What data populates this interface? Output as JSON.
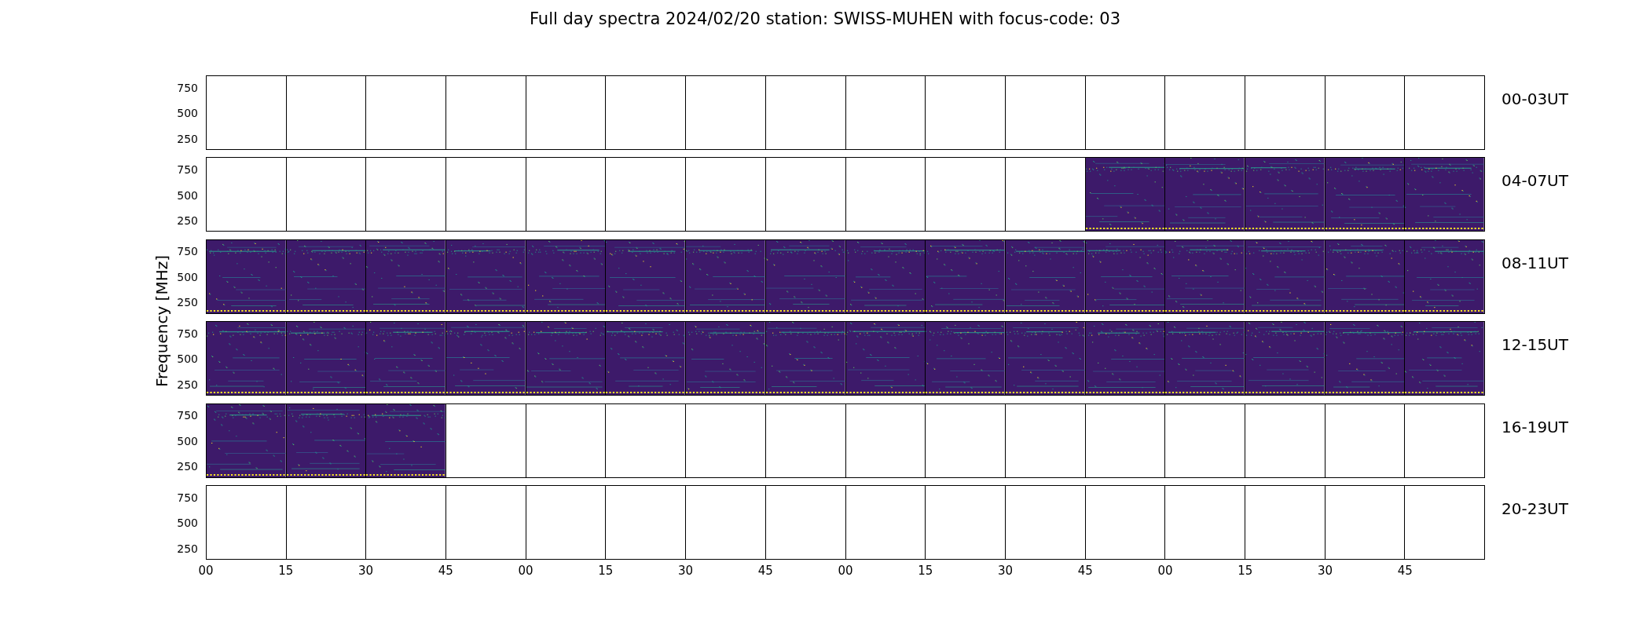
{
  "title": "Full day spectra 2024/02/20 station: SWISS-MUHEN with focus-code: 03",
  "ylabel": "Frequency [MHz]",
  "rows": [
    {
      "label": "00-03UT",
      "yticks": [
        "750",
        "500",
        "250"
      ],
      "panels": [
        {
          "filled": false
        },
        {
          "filled": false
        },
        {
          "filled": false
        },
        {
          "filled": false
        },
        {
          "filled": false
        },
        {
          "filled": false
        },
        {
          "filled": false
        },
        {
          "filled": false
        },
        {
          "filled": false
        },
        {
          "filled": false
        },
        {
          "filled": false
        },
        {
          "filled": false
        },
        {
          "filled": false
        },
        {
          "filled": false
        },
        {
          "filled": false
        },
        {
          "filled": false
        }
      ]
    },
    {
      "label": "04-07UT",
      "yticks": [
        "750",
        "500",
        "250"
      ],
      "panels": [
        {
          "filled": false
        },
        {
          "filled": false
        },
        {
          "filled": false
        },
        {
          "filled": false
        },
        {
          "filled": false
        },
        {
          "filled": false
        },
        {
          "filled": false
        },
        {
          "filled": false
        },
        {
          "filled": false
        },
        {
          "filled": false
        },
        {
          "filled": false
        },
        {
          "filled": true
        },
        {
          "filled": true
        },
        {
          "filled": true
        },
        {
          "filled": true
        },
        {
          "filled": true
        }
      ]
    },
    {
      "label": "08-11UT",
      "yticks": [
        "750",
        "500",
        "250"
      ],
      "panels": [
        {
          "filled": true
        },
        {
          "filled": true
        },
        {
          "filled": true
        },
        {
          "filled": true
        },
        {
          "filled": true
        },
        {
          "filled": true
        },
        {
          "filled": true
        },
        {
          "filled": true
        },
        {
          "filled": true
        },
        {
          "filled": true
        },
        {
          "filled": true
        },
        {
          "filled": true
        },
        {
          "filled": true
        },
        {
          "filled": true
        },
        {
          "filled": true
        },
        {
          "filled": true
        }
      ]
    },
    {
      "label": "12-15UT",
      "yticks": [
        "750",
        "500",
        "250"
      ],
      "panels": [
        {
          "filled": true
        },
        {
          "filled": true
        },
        {
          "filled": true
        },
        {
          "filled": true
        },
        {
          "filled": true
        },
        {
          "filled": true
        },
        {
          "filled": true
        },
        {
          "filled": true
        },
        {
          "filled": true
        },
        {
          "filled": true
        },
        {
          "filled": true
        },
        {
          "filled": true
        },
        {
          "filled": true
        },
        {
          "filled": true
        },
        {
          "filled": true
        },
        {
          "filled": true
        }
      ]
    },
    {
      "label": "16-19UT",
      "yticks": [
        "750",
        "500",
        "250"
      ],
      "panels": [
        {
          "filled": true
        },
        {
          "filled": true
        },
        {
          "filled": true
        },
        {
          "filled": false
        },
        {
          "filled": false
        },
        {
          "filled": false
        },
        {
          "filled": false
        },
        {
          "filled": false
        },
        {
          "filled": false
        },
        {
          "filled": false
        },
        {
          "filled": false
        },
        {
          "filled": false
        },
        {
          "filled": false
        },
        {
          "filled": false
        },
        {
          "filled": false
        },
        {
          "filled": false
        }
      ]
    },
    {
      "label": "20-23UT",
      "yticks": [
        "750",
        "500",
        "250"
      ],
      "panels": [
        {
          "filled": false
        },
        {
          "filled": false
        },
        {
          "filled": false
        },
        {
          "filled": false
        },
        {
          "filled": false
        },
        {
          "filled": false
        },
        {
          "filled": false
        },
        {
          "filled": false
        },
        {
          "filled": false
        },
        {
          "filled": false
        },
        {
          "filled": false
        },
        {
          "filled": false
        },
        {
          "filled": false
        },
        {
          "filled": false
        },
        {
          "filled": false
        },
        {
          "filled": false
        }
      ]
    }
  ],
  "xticks": [
    "00",
    "15",
    "30",
    "45",
    "00",
    "15",
    "30",
    "45",
    "00",
    "15",
    "30",
    "45",
    "00",
    "15",
    "30",
    "45"
  ]
}
